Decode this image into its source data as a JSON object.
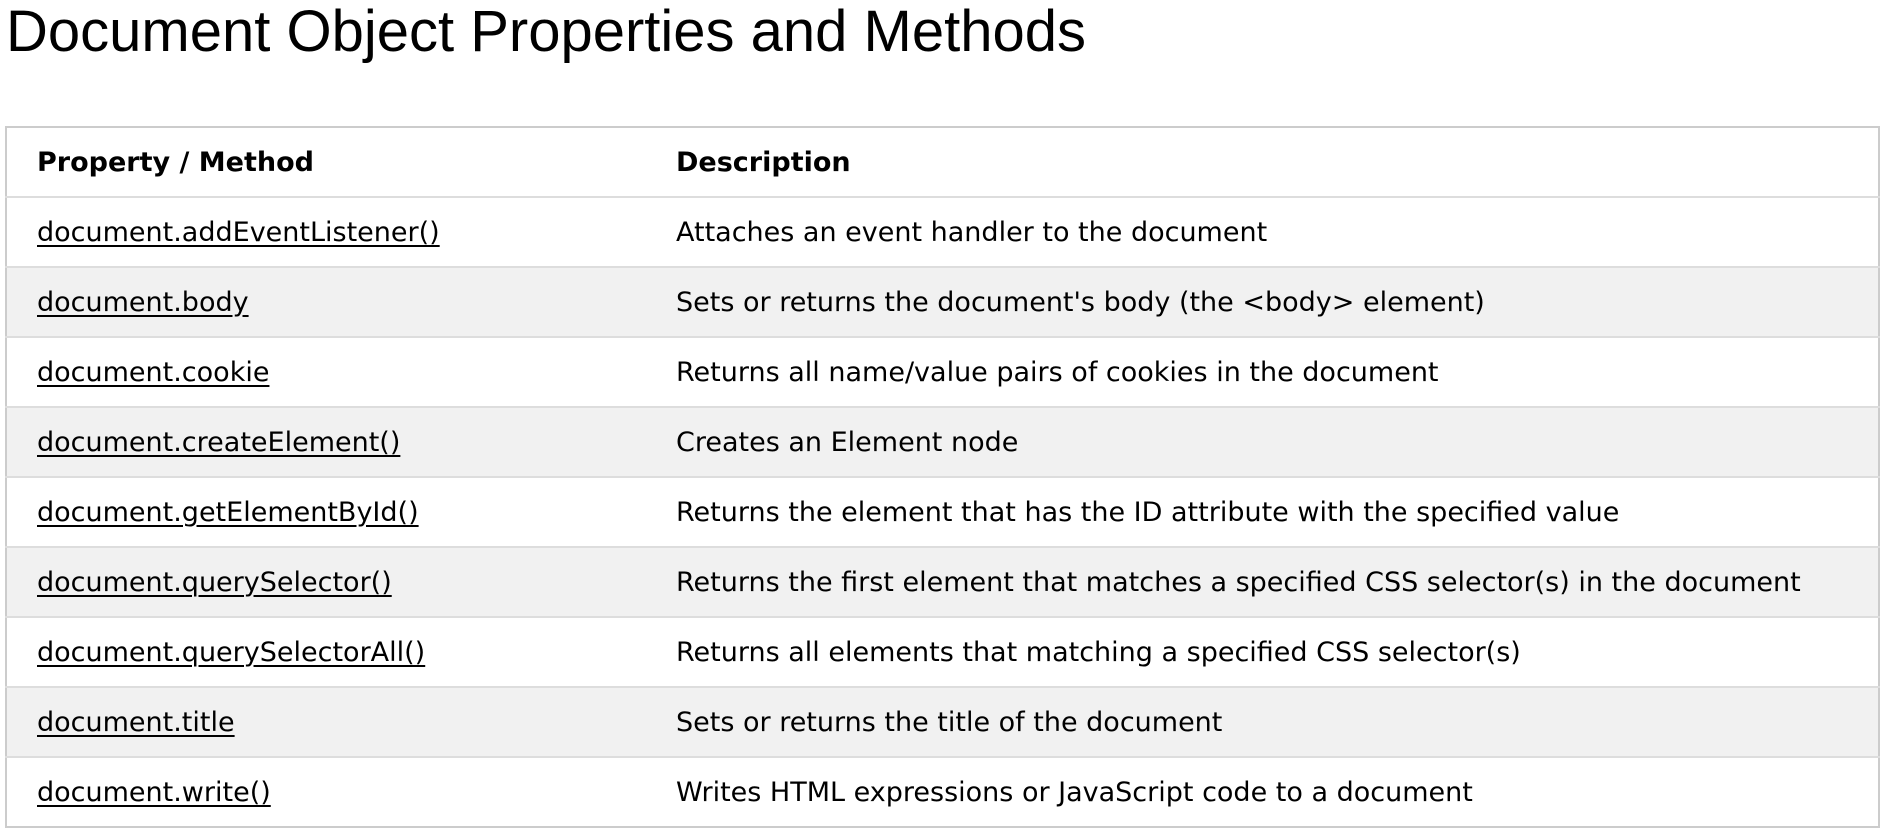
{
  "page": {
    "title": "Document Object Properties and Methods"
  },
  "table": {
    "headers": {
      "property": "Property / Method",
      "description": "Description"
    },
    "rows": [
      {
        "name": "document.addEventListener()",
        "description": "Attaches an event handler to the document"
      },
      {
        "name": "document.body",
        "description": "Sets or returns the document's body (the <body> element)"
      },
      {
        "name": "document.cookie",
        "description": "Returns all name/value pairs of cookies in the document"
      },
      {
        "name": "document.createElement()",
        "description": "Creates an Element node"
      },
      {
        "name": "document.getElementById()",
        "description": "Returns the element that has the ID attribute with the specified value"
      },
      {
        "name": "document.querySelector()",
        "description": "Returns the first element that matches a specified CSS selector(s) in the document"
      },
      {
        "name": "document.querySelectorAll()",
        "description": "Returns all elements that matching a specified CSS selector(s)"
      },
      {
        "name": "document.title",
        "description": "Sets or returns the title of the document"
      },
      {
        "name": "document.write()",
        "description": "Writes HTML expressions or JavaScript code to a document"
      }
    ]
  }
}
